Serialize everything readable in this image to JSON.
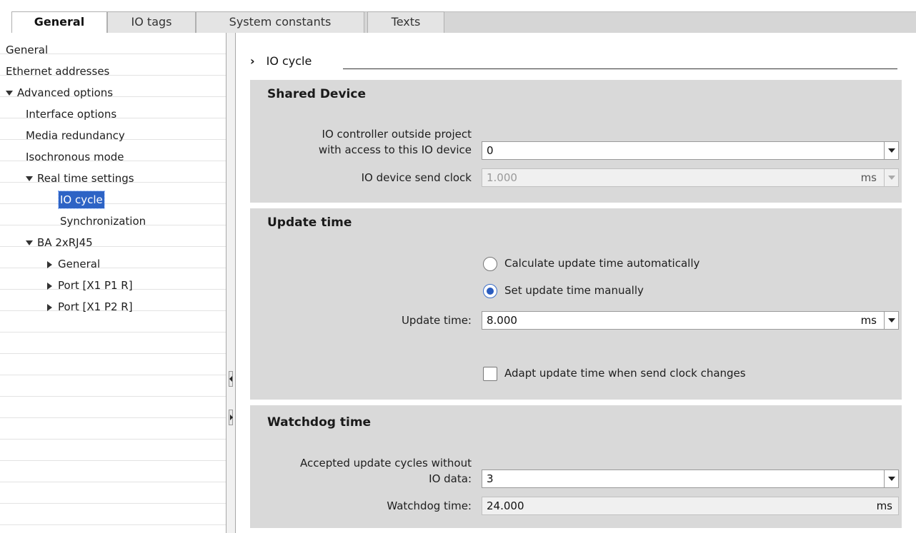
{
  "tabs": [
    {
      "label": "General",
      "active": true
    },
    {
      "label": "IO tags",
      "active": false
    },
    {
      "label": "System constants",
      "active": false
    },
    {
      "label": "Texts",
      "active": false
    }
  ],
  "tree": {
    "items": [
      {
        "label": "General"
      },
      {
        "label": "Ethernet addresses"
      },
      {
        "label": "Advanced options",
        "expanded": true
      },
      {
        "label": "Interface options"
      },
      {
        "label": "Media redundancy"
      },
      {
        "label": "Isochronous mode"
      },
      {
        "label": "Real time settings",
        "expanded": true
      },
      {
        "label": "IO cycle",
        "selected": true
      },
      {
        "label": "Synchronization"
      },
      {
        "label": "BA 2xRJ45",
        "expanded": true
      },
      {
        "label": "General",
        "expanded": false
      },
      {
        "label": "Port [X1 P1 R]",
        "expanded": false
      },
      {
        "label": "Port [X1 P2 R]",
        "expanded": false
      }
    ]
  },
  "breadcrumb": {
    "chevron": "›",
    "title": "IO cycle"
  },
  "shared_device": {
    "title": "Shared Device",
    "controller_label_line1": "IO controller outside project",
    "controller_label_line2": "with access to this IO device",
    "controller_value": "0",
    "send_clock_label": "IO device send clock",
    "send_clock_value": "1.000",
    "send_clock_unit": "ms"
  },
  "update_time": {
    "title": "Update time",
    "radio_auto_label": "Calculate update time automatically",
    "radio_manual_label": "Set update time manually",
    "selected_mode": "manual",
    "update_label": "Update time:",
    "update_value": "8.000",
    "update_unit": "ms",
    "adapt_label": "Adapt update time when send clock changes",
    "adapt_checked": false
  },
  "watchdog": {
    "title": "Watchdog time",
    "cycles_label_line1": "Accepted update cycles without",
    "cycles_label_line2": "IO data:",
    "cycles_value": "3",
    "watchdog_label": "Watchdog time:",
    "watchdog_value": "24.000",
    "watchdog_unit": "ms"
  }
}
